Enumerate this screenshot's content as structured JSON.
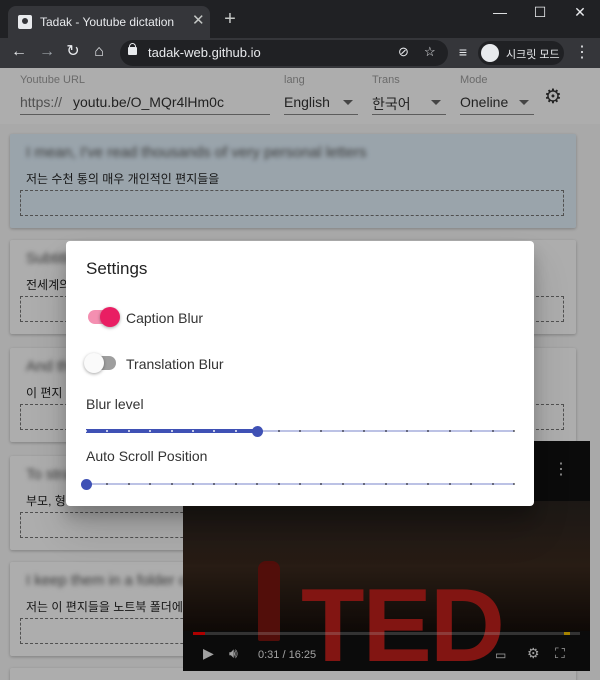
{
  "browser": {
    "tab_title": "Tadak - Youtube dictation",
    "tab_close": "✕",
    "new_tab": "+",
    "url": "tadak-web.github.io",
    "incognito_label": "시크릿 모드",
    "window_controls": [
      "—",
      "☐",
      "✕"
    ]
  },
  "header": {
    "url_field": {
      "label": "Youtube URL",
      "prefix": "https://",
      "value": "youtu.be/O_MQr4lHm0c"
    },
    "lang_field": {
      "label": "lang",
      "value": "English"
    },
    "trans_field": {
      "label": "Trans",
      "value": "한국어"
    },
    "mode_field": {
      "label": "Mode",
      "value": "Oneline"
    }
  },
  "cards": [
    {
      "en": "I mean, I've read thousands of very personal letters",
      "ko": "저는 수천 통의 매우 개인적인 편지들을"
    },
    {
      "en": "Subtitle line hidden",
      "ko": "전세계의"
    },
    {
      "en": "And these letters",
      "ko": "이 편지"
    },
    {
      "en": "To strangers",
      "ko": "부모, 형"
    },
    {
      "en": "I keep them in a folder on my laptop",
      "ko": "저는 이 편지들을 노트북 폴더에"
    }
  ],
  "video": {
    "time": "0:31 / 16:25",
    "logo": "TED",
    "progress": 0.032
  },
  "dialog": {
    "title": "Settings",
    "caption_blur": {
      "label": "Caption Blur",
      "on": true
    },
    "translation_blur": {
      "label": "Translation Blur",
      "on": false
    },
    "blur_level": {
      "label": "Blur level",
      "value": 8,
      "max": 20
    },
    "auto_scroll": {
      "label": "Auto Scroll Position",
      "value": 0,
      "max": 20
    }
  },
  "colors": {
    "switch_on_thumb": "#e91e63",
    "switch_on_track": "#f48fb1",
    "slider_primary": "#3f51b5"
  }
}
